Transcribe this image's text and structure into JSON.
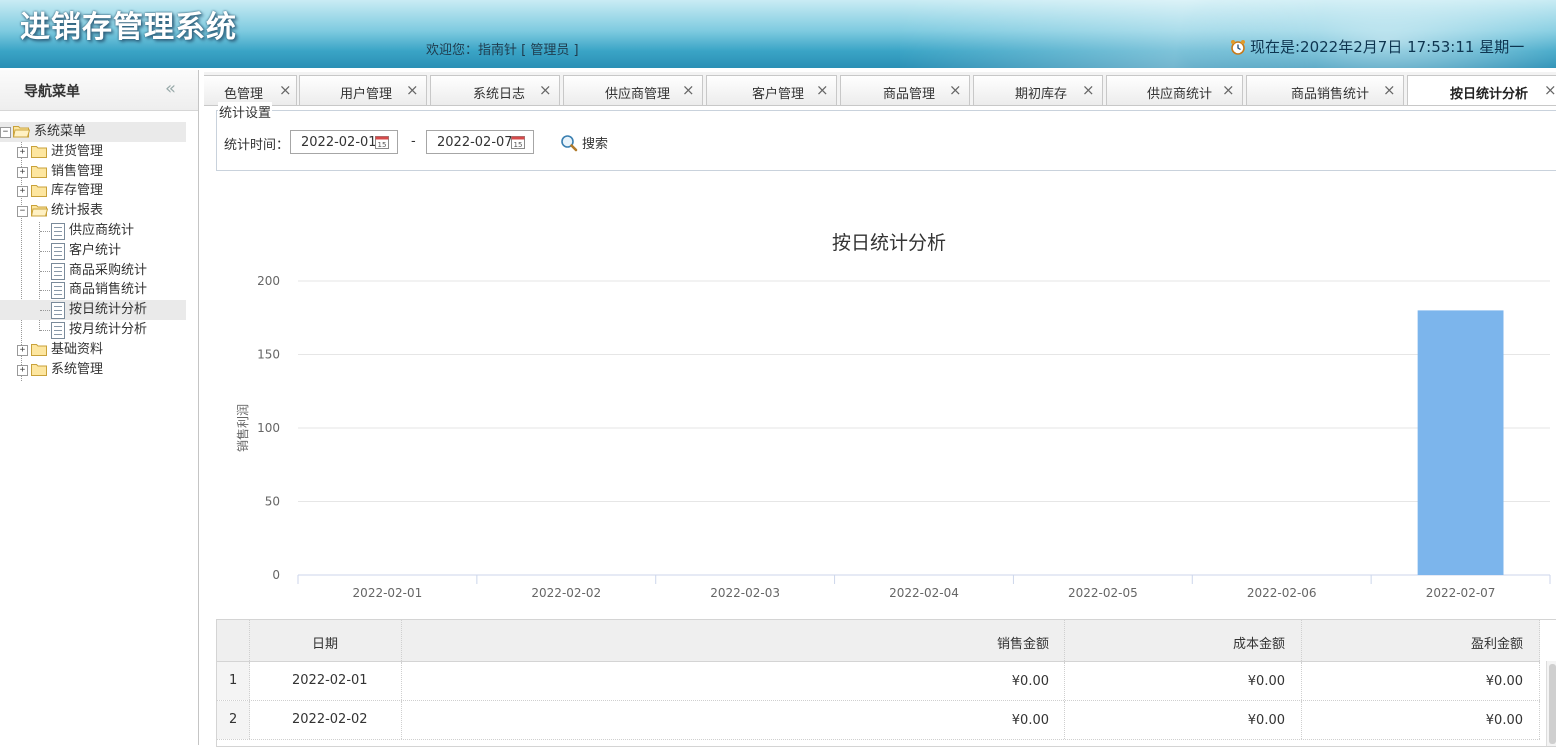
{
  "header": {
    "app_title": "进销存管理系统",
    "welcome": "欢迎您：指南针 [ 管理员 ]",
    "clock_text": "现在是:2022年2月7日 17:53:11 星期一"
  },
  "nav": {
    "title": "导航菜单",
    "collapse_glyph": "«",
    "root": "系统菜单",
    "items": [
      {
        "label": "进货管理"
      },
      {
        "label": "销售管理"
      },
      {
        "label": "库存管理"
      },
      {
        "label": "统计报表"
      },
      {
        "label": "基础资料"
      },
      {
        "label": "系统管理"
      }
    ],
    "report_children": [
      {
        "label": "供应商统计"
      },
      {
        "label": "客户统计"
      },
      {
        "label": "商品采购统计"
      },
      {
        "label": "商品销售统计"
      },
      {
        "label": "按日统计分析"
      },
      {
        "label": "按月统计分析"
      }
    ]
  },
  "tabs": [
    {
      "label": "色管理"
    },
    {
      "label": "用户管理"
    },
    {
      "label": "系统日志"
    },
    {
      "label": "供应商管理"
    },
    {
      "label": "客户管理"
    },
    {
      "label": "商品管理"
    },
    {
      "label": "期初库存"
    },
    {
      "label": "供应商统计"
    },
    {
      "label": "商品销售统计"
    },
    {
      "label": "按日统计分析"
    }
  ],
  "tab_close_glyph": "×",
  "stats": {
    "legend": "统计设置",
    "time_label": "统计时间：",
    "start_date": "2022-02-01",
    "end_date": "2022-02-07",
    "dash": "-",
    "search_label": "搜索"
  },
  "chart_data": {
    "type": "bar",
    "title": "按日统计分析",
    "ylabel": "销售利润",
    "xlabel": "",
    "categories": [
      "2022-02-01",
      "2022-02-02",
      "2022-02-03",
      "2022-02-04",
      "2022-02-05",
      "2022-02-06",
      "2022-02-07"
    ],
    "values": [
      0,
      0,
      0,
      0,
      0,
      0,
      180
    ],
    "ylim": [
      0,
      200
    ],
    "yticks": [
      0,
      50,
      100,
      150,
      200
    ],
    "bar_color": "#7cb5ec",
    "grid": true
  },
  "table": {
    "columns": [
      "",
      "日期",
      "销售金额",
      "成本金额",
      "盈利金额"
    ],
    "rows": [
      {
        "n": "1",
        "date": "2022-02-01",
        "sales": "¥0.00",
        "cost": "¥0.00",
        "profit": "¥0.00"
      },
      {
        "n": "2",
        "date": "2022-02-02",
        "sales": "¥0.00",
        "cost": "¥0.00",
        "profit": "¥0.00"
      }
    ]
  }
}
